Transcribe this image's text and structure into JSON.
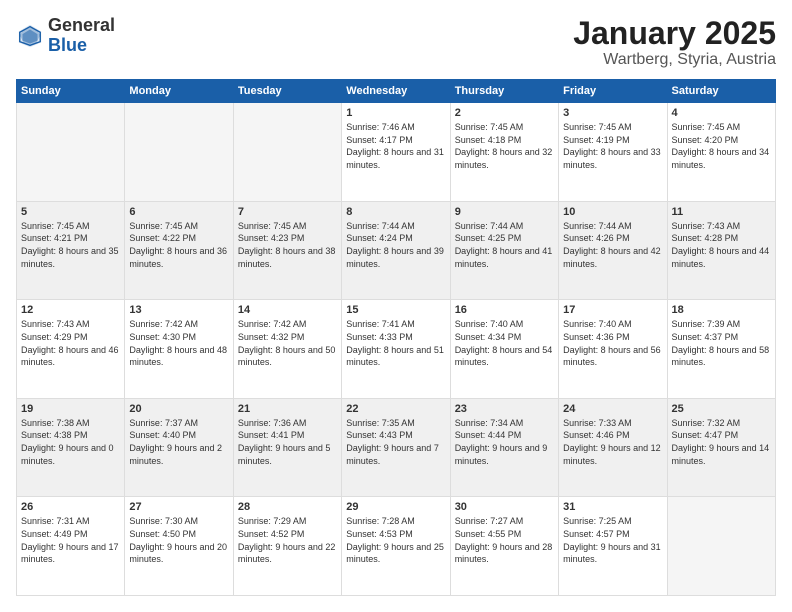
{
  "header": {
    "logo_general": "General",
    "logo_blue": "Blue",
    "month": "January 2025",
    "location": "Wartberg, Styria, Austria"
  },
  "days_header": [
    "Sunday",
    "Monday",
    "Tuesday",
    "Wednesday",
    "Thursday",
    "Friday",
    "Saturday"
  ],
  "weeks": [
    [
      {
        "day": "",
        "info": ""
      },
      {
        "day": "",
        "info": ""
      },
      {
        "day": "",
        "info": ""
      },
      {
        "day": "1",
        "info": "Sunrise: 7:46 AM\nSunset: 4:17 PM\nDaylight: 8 hours and 31 minutes."
      },
      {
        "day": "2",
        "info": "Sunrise: 7:45 AM\nSunset: 4:18 PM\nDaylight: 8 hours and 32 minutes."
      },
      {
        "day": "3",
        "info": "Sunrise: 7:45 AM\nSunset: 4:19 PM\nDaylight: 8 hours and 33 minutes."
      },
      {
        "day": "4",
        "info": "Sunrise: 7:45 AM\nSunset: 4:20 PM\nDaylight: 8 hours and 34 minutes."
      }
    ],
    [
      {
        "day": "5",
        "info": "Sunrise: 7:45 AM\nSunset: 4:21 PM\nDaylight: 8 hours and 35 minutes."
      },
      {
        "day": "6",
        "info": "Sunrise: 7:45 AM\nSunset: 4:22 PM\nDaylight: 8 hours and 36 minutes."
      },
      {
        "day": "7",
        "info": "Sunrise: 7:45 AM\nSunset: 4:23 PM\nDaylight: 8 hours and 38 minutes."
      },
      {
        "day": "8",
        "info": "Sunrise: 7:44 AM\nSunset: 4:24 PM\nDaylight: 8 hours and 39 minutes."
      },
      {
        "day": "9",
        "info": "Sunrise: 7:44 AM\nSunset: 4:25 PM\nDaylight: 8 hours and 41 minutes."
      },
      {
        "day": "10",
        "info": "Sunrise: 7:44 AM\nSunset: 4:26 PM\nDaylight: 8 hours and 42 minutes."
      },
      {
        "day": "11",
        "info": "Sunrise: 7:43 AM\nSunset: 4:28 PM\nDaylight: 8 hours and 44 minutes."
      }
    ],
    [
      {
        "day": "12",
        "info": "Sunrise: 7:43 AM\nSunset: 4:29 PM\nDaylight: 8 hours and 46 minutes."
      },
      {
        "day": "13",
        "info": "Sunrise: 7:42 AM\nSunset: 4:30 PM\nDaylight: 8 hours and 48 minutes."
      },
      {
        "day": "14",
        "info": "Sunrise: 7:42 AM\nSunset: 4:32 PM\nDaylight: 8 hours and 50 minutes."
      },
      {
        "day": "15",
        "info": "Sunrise: 7:41 AM\nSunset: 4:33 PM\nDaylight: 8 hours and 51 minutes."
      },
      {
        "day": "16",
        "info": "Sunrise: 7:40 AM\nSunset: 4:34 PM\nDaylight: 8 hours and 54 minutes."
      },
      {
        "day": "17",
        "info": "Sunrise: 7:40 AM\nSunset: 4:36 PM\nDaylight: 8 hours and 56 minutes."
      },
      {
        "day": "18",
        "info": "Sunrise: 7:39 AM\nSunset: 4:37 PM\nDaylight: 8 hours and 58 minutes."
      }
    ],
    [
      {
        "day": "19",
        "info": "Sunrise: 7:38 AM\nSunset: 4:38 PM\nDaylight: 9 hours and 0 minutes."
      },
      {
        "day": "20",
        "info": "Sunrise: 7:37 AM\nSunset: 4:40 PM\nDaylight: 9 hours and 2 minutes."
      },
      {
        "day": "21",
        "info": "Sunrise: 7:36 AM\nSunset: 4:41 PM\nDaylight: 9 hours and 5 minutes."
      },
      {
        "day": "22",
        "info": "Sunrise: 7:35 AM\nSunset: 4:43 PM\nDaylight: 9 hours and 7 minutes."
      },
      {
        "day": "23",
        "info": "Sunrise: 7:34 AM\nSunset: 4:44 PM\nDaylight: 9 hours and 9 minutes."
      },
      {
        "day": "24",
        "info": "Sunrise: 7:33 AM\nSunset: 4:46 PM\nDaylight: 9 hours and 12 minutes."
      },
      {
        "day": "25",
        "info": "Sunrise: 7:32 AM\nSunset: 4:47 PM\nDaylight: 9 hours and 14 minutes."
      }
    ],
    [
      {
        "day": "26",
        "info": "Sunrise: 7:31 AM\nSunset: 4:49 PM\nDaylight: 9 hours and 17 minutes."
      },
      {
        "day": "27",
        "info": "Sunrise: 7:30 AM\nSunset: 4:50 PM\nDaylight: 9 hours and 20 minutes."
      },
      {
        "day": "28",
        "info": "Sunrise: 7:29 AM\nSunset: 4:52 PM\nDaylight: 9 hours and 22 minutes."
      },
      {
        "day": "29",
        "info": "Sunrise: 7:28 AM\nSunset: 4:53 PM\nDaylight: 9 hours and 25 minutes."
      },
      {
        "day": "30",
        "info": "Sunrise: 7:27 AM\nSunset: 4:55 PM\nDaylight: 9 hours and 28 minutes."
      },
      {
        "day": "31",
        "info": "Sunrise: 7:25 AM\nSunset: 4:57 PM\nDaylight: 9 hours and 31 minutes."
      },
      {
        "day": "",
        "info": ""
      }
    ]
  ]
}
